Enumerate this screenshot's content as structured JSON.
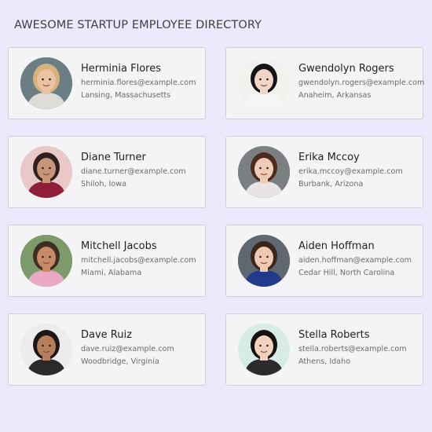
{
  "page": {
    "title": "AWESOME STARTUP EMPLOYEE DIRECTORY",
    "background": "#eaeafc"
  },
  "employees": [
    {
      "name": "Herminia Flores",
      "email": "herminia.flores@example.com",
      "location": "Lansing, Massachusetts",
      "avatar_bg": "#6b7e83",
      "avatar_skin": "#e9c3a4",
      "avatar_hair": "#d8b27a",
      "avatar_shirt": "#dddcd8"
    },
    {
      "name": "Gwendolyn Rogers",
      "email": "gwendolyn.rogers@example.com",
      "location": "Anaheim, Arkansas",
      "avatar_bg": "#f1f1ee",
      "avatar_skin": "#f0d6c4",
      "avatar_hair": "#141416",
      "avatar_shirt": "#f5f5f3"
    },
    {
      "name": "Diane Turner",
      "email": "diane.turner@example.com",
      "location": "Shiloh, Iowa",
      "avatar_bg": "#e8c9c8",
      "avatar_skin": "#c6957a",
      "avatar_hair": "#2f2020",
      "avatar_shirt": "#8f1f38"
    },
    {
      "name": "Erika Mccoy",
      "email": "erika.mccoy@example.com",
      "location": "Burbank, Arizona",
      "avatar_bg": "#7c7f82",
      "avatar_skin": "#f0cbb8",
      "avatar_hair": "#4a2b1e",
      "avatar_shirt": "#e9e3e4"
    },
    {
      "name": "Mitchell Jacobs",
      "email": "mitchell.jacobs@example.com",
      "location": "Miami, Alabama",
      "avatar_bg": "#7d9a6a",
      "avatar_skin": "#c88a64",
      "avatar_hair": "#3d2d24",
      "avatar_shirt": "#e9a9c4"
    },
    {
      "name": "Aiden Hoffman",
      "email": "aiden.hoffman@example.com",
      "location": "Cedar Hill, North Carolina",
      "avatar_bg": "#5f6871",
      "avatar_skin": "#f0c9b2",
      "avatar_hair": "#3b2619",
      "avatar_shirt": "#223a8c"
    },
    {
      "name": "Dave Ruiz",
      "email": "dave.ruiz@example.com",
      "location": "Woodbridge, Virginia",
      "avatar_bg": "#ececec",
      "avatar_skin": "#b57f5b",
      "avatar_hair": "#1b1717",
      "avatar_shirt": "#2a2a2a"
    },
    {
      "name": "Stella Roberts",
      "email": "stella.roberts@example.com",
      "location": "Athens, Idaho",
      "avatar_bg": "#d7ece4",
      "avatar_skin": "#f1d2bf",
      "avatar_hair": "#15110f",
      "avatar_shirt": "#2b2b2e"
    }
  ]
}
